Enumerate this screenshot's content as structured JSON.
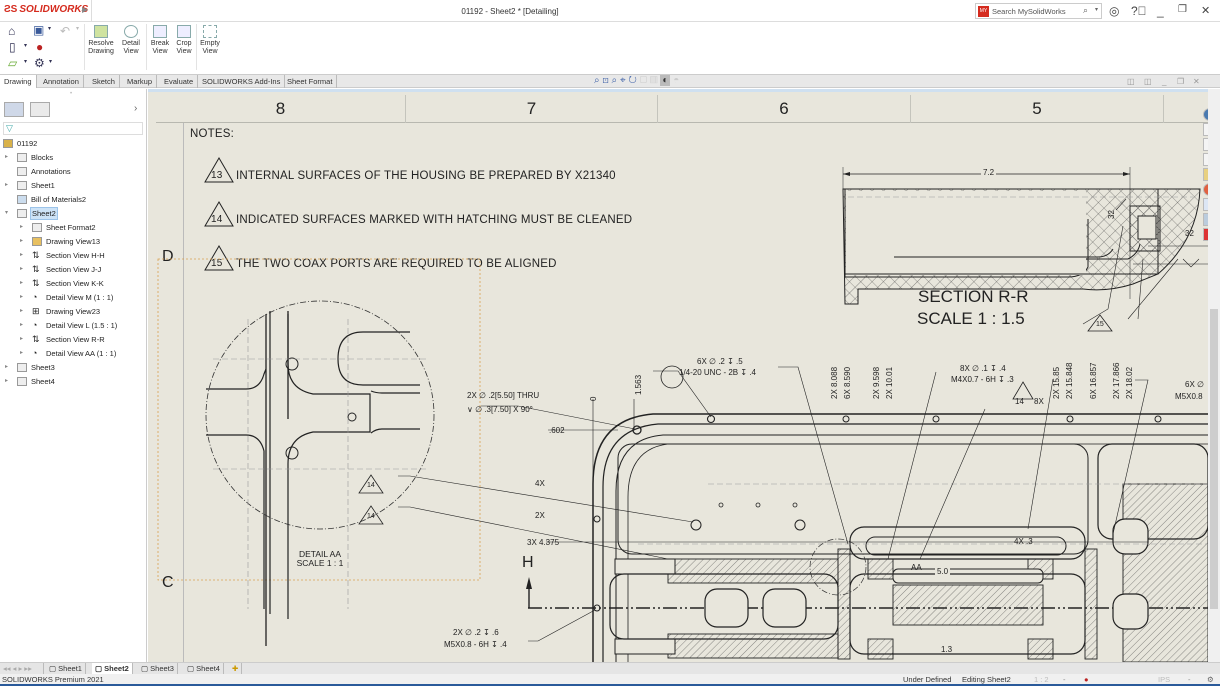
{
  "app": {
    "logo": "SOLIDWORKS",
    "title": "01192 - Sheet2 * [Detailing]",
    "search_placeholder": "Search MySolidWorks"
  },
  "ribbon": {
    "buttons": [
      {
        "label": "Resolve Drawing",
        "icon": "resolve-drawing-icon"
      },
      {
        "label": "Detail View",
        "icon": "detail-view-icon"
      },
      {
        "label": "Break View",
        "icon": "break-view-icon"
      },
      {
        "label": "Crop View",
        "icon": "crop-view-icon"
      },
      {
        "label": "Empty View",
        "icon": "empty-view-icon"
      }
    ],
    "tabs": [
      "Drawing",
      "Annotation",
      "Sketch",
      "Markup",
      "Evaluate",
      "SOLIDWORKS Add-Ins",
      "Sheet Format"
    ],
    "active_tab": "Drawing"
  },
  "tree": {
    "root": "01192",
    "items": [
      {
        "label": "Blocks",
        "level": 1,
        "expander": true
      },
      {
        "label": "Annotations",
        "level": 1,
        "expander": false
      },
      {
        "label": "Sheet1",
        "level": 1,
        "expander": true
      },
      {
        "label": "Bill of Materials2",
        "level": 1,
        "expander": false
      },
      {
        "label": "Sheet2",
        "level": 1,
        "expander": true,
        "expanded": true,
        "selected": true
      },
      {
        "label": "Sheet Format2",
        "level": 2,
        "expander": true
      },
      {
        "label": "Drawing View13",
        "level": 2,
        "expander": true
      },
      {
        "label": "Section View H-H",
        "level": 2,
        "expander": true
      },
      {
        "label": "Section View J-J",
        "level": 2,
        "expander": true
      },
      {
        "label": "Section View K-K",
        "level": 2,
        "expander": true
      },
      {
        "label": "Detail View M (1 : 1)",
        "level": 2,
        "expander": true
      },
      {
        "label": "Drawing View23",
        "level": 2,
        "expander": true
      },
      {
        "label": "Detail View L (1.5 : 1)",
        "level": 2,
        "expander": true
      },
      {
        "label": "Section View R-R",
        "level": 2,
        "expander": true
      },
      {
        "label": "Detail View AA (1 : 1)",
        "level": 2,
        "expander": true
      },
      {
        "label": "Sheet3",
        "level": 1,
        "expander": true
      },
      {
        "label": "Sheet4",
        "level": 1,
        "expander": true
      }
    ]
  },
  "drawing": {
    "zones": [
      "8",
      "7",
      "6",
      "5"
    ],
    "row_labels": [
      "D",
      "C"
    ],
    "notes_title": "NOTES:",
    "notes": [
      {
        "num": "13",
        "text": "INTERNAL SURFACES OF THE HOUSING BE PREPARED BY X21340"
      },
      {
        "num": "14",
        "text": "INDICATED SURFACES MARKED WITH  HATCHING MUST BE CLEANED"
      },
      {
        "num": "15",
        "text": "THE TWO COAX PORTS ARE REQUIRED TO BE ALIGNED"
      }
    ],
    "detail_view": {
      "title": "DETAIL AA",
      "scale": "SCALE 1 : 1"
    },
    "section_view": {
      "title": "SECTION R-R",
      "scale": "SCALE 1 : 1.5",
      "dim_width": "7.2",
      "angle1": "32",
      "angle2": "32",
      "note_ref": "15"
    },
    "callouts": {
      "c1_l1": "2X ∅ .2[5.50] THRU",
      "c1_l2": "∨ ∅ .3[7.50] X 90°",
      "c2_l1": "6X ∅ .2 ↧ .5",
      "c2_l2": "1/4-20 UNC - 2B ↧ .4",
      "c3_l1": "8X ∅ .1 ↧ .4",
      "c3_l2": "M4X0.7 - 6H ↧ .3",
      "c4_l1": "6X ∅",
      "c4_l2": "M5X0.8",
      "c5_l1": "2X ∅ .2 ↧ .6",
      "c5_l2": "M5X0.8 - 6H ↧ .4",
      "ref_8x": "8X",
      "ref_14": "14",
      "ref_4x": "4X",
      "ref_2x": "2X",
      "dim_602": ".602",
      "dim_3x": "3X 4.375",
      "dim_1563": "1.563",
      "dim_0": "0",
      "dim_4x3": "4X .3",
      "dim_50": "5.0",
      "dim_13": "1.3",
      "detail_ref": "AA",
      "section_label": "H"
    },
    "ordinates": [
      "2X 8.088",
      "6X 8.590",
      "2X 9.598",
      "2X 10.01",
      "2X 15.85",
      "2X 15.848",
      "6X 16.857",
      "2X 17.866",
      "2X 18.02"
    ]
  },
  "sheet_tabs": [
    "Sheet1",
    "Sheet2",
    "Sheet3",
    "Sheet4"
  ],
  "active_sheet": "Sheet2",
  "status": {
    "product": "SOLIDWORKS Premium 2021",
    "definition": "Under Defined",
    "editing": "Editing Sheet2",
    "scale": "1 : 2",
    "units": "IPS"
  }
}
